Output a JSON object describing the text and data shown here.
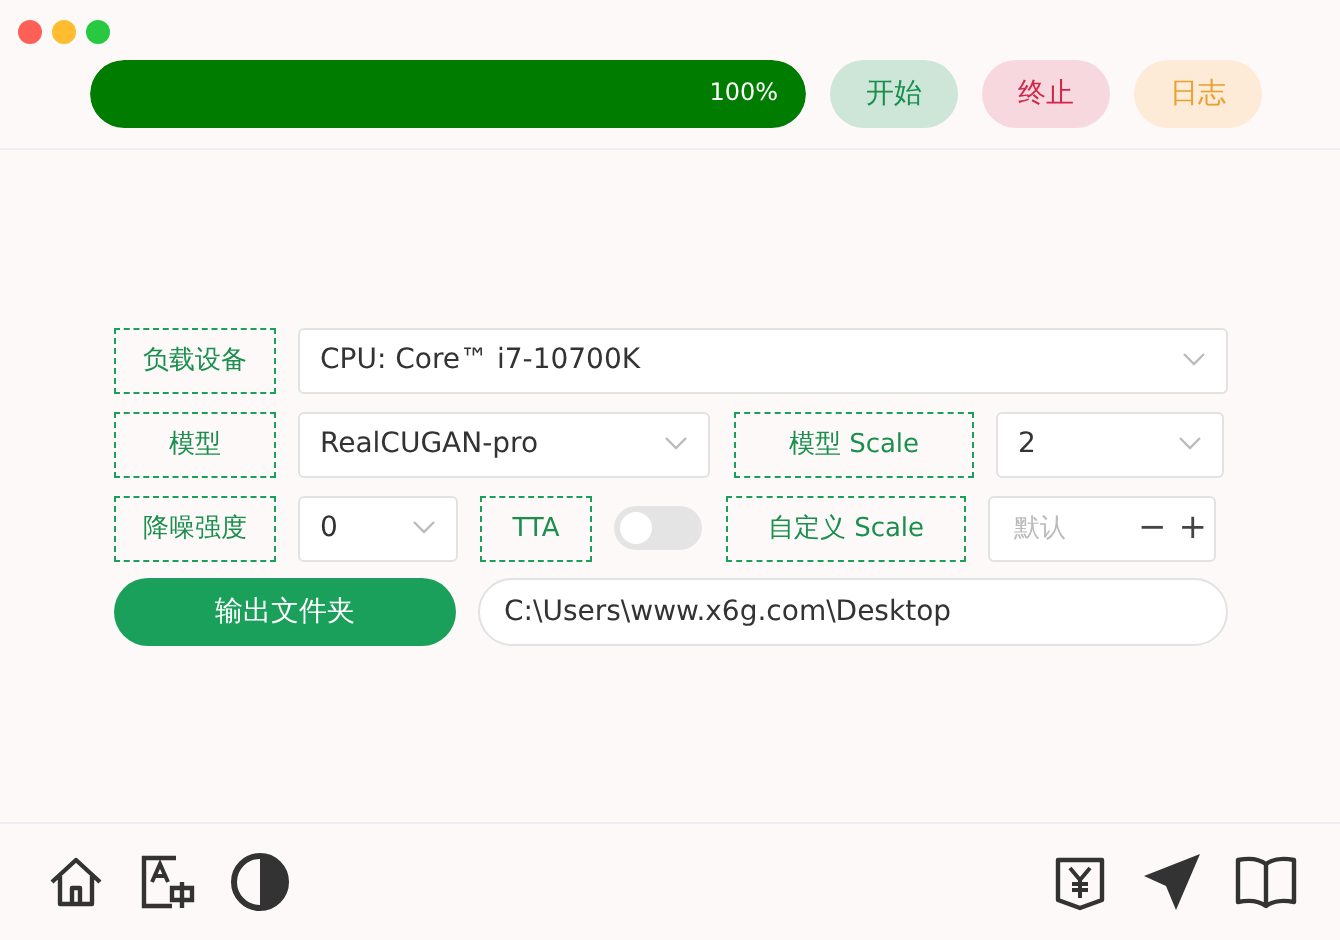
{
  "progress": {
    "level": 1,
    "reading": "100%"
  },
  "actions": [
    {
      "label": "开始",
      "kind": "start"
    },
    {
      "label": "终止",
      "kind": "stop"
    },
    {
      "label": "日志",
      "kind": "log"
    }
  ],
  "form": [
    {
      "kind": "wide",
      "label": "负载设备",
      "value": "CPU: Core™ i7-10700K"
    },
    {
      "kind": "pair",
      "label": "模型",
      "value": "RealCUGAN-pro",
      "label2": "模型 Scale",
      "value2": "2"
    },
    {
      "kind": "mixed",
      "label": "降噪强度",
      "value": "0",
      "toggle_label": "TTA",
      "toggle_on": false,
      "label2": "自定义 Scale",
      "placeholder": "默认",
      "minus": "−",
      "plus": "+"
    },
    {
      "kind": "output",
      "button": "输出文件夹",
      "path": "C:\\Users\\www.x6g.com\\Desktop"
    }
  ]
}
